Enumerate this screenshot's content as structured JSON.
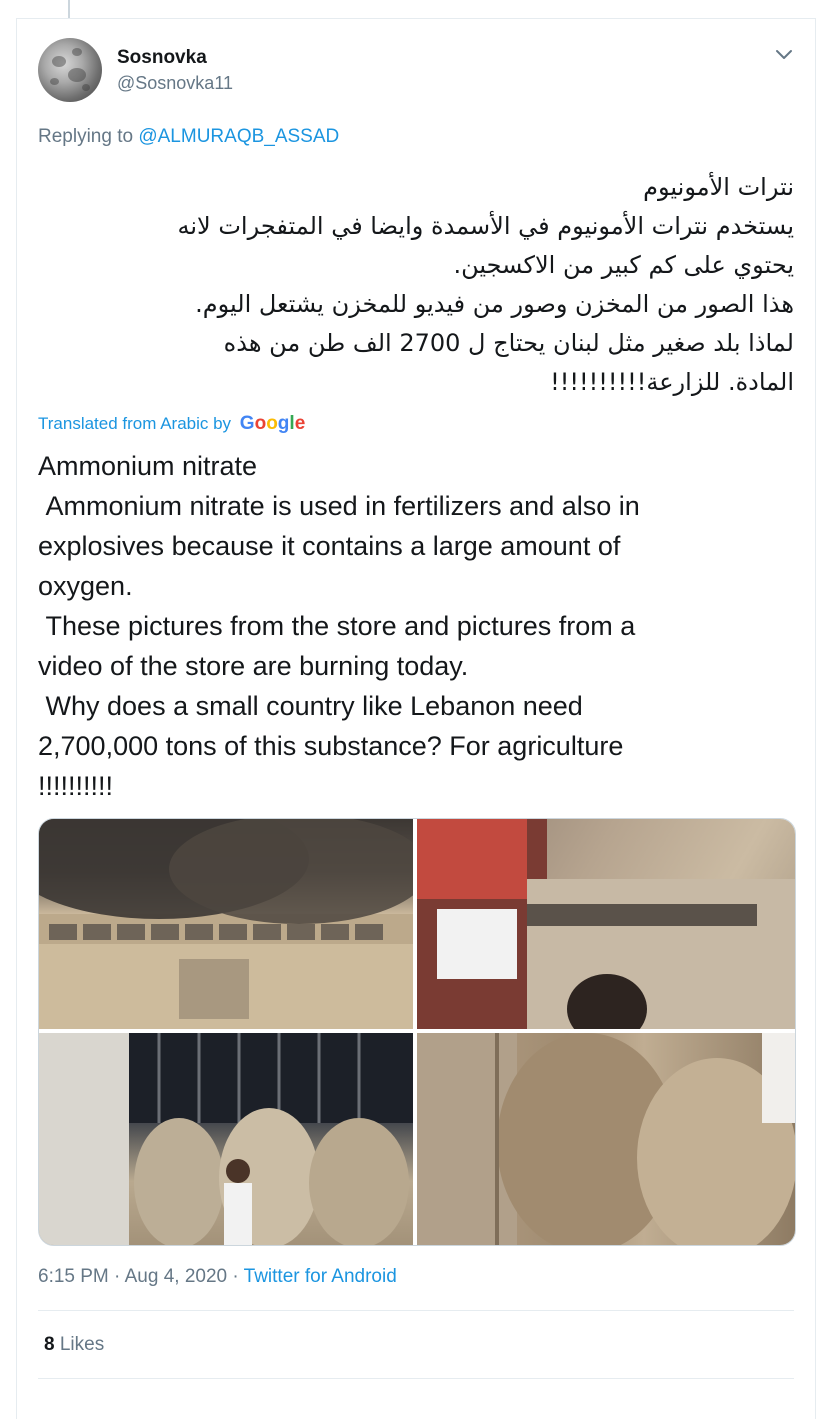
{
  "tweet": {
    "author_name": "Sosnovka",
    "author_handle": "@Sosnovka11",
    "replying_prefix": "Replying to",
    "replying_to": "@ALMURAQB_ASSAD",
    "arabic_lines": [
      "نترات الأمونيوم",
      "يستخدم نترات الأمونيوم في الأسمدة وايضا في المتفجرات لانه",
      "يحتوي على كم كبير من الاكسجين.",
      "هذا الصور من المخزن وصور من فيديو للمخزن يشتعل اليوم.",
      "لماذا بلد صغير مثل لبنان يحتاج ل 2700 الف طن من هذه",
      "المادة. للزارعة!!!!!!!!!!"
    ],
    "translated_label": "Translated from Arabic by",
    "translator_brand": "Google",
    "translation": "Ammonium nitrate\n Ammonium nitrate is used in fertilizers and also in\nexplosives because it contains a large amount of\noxygen.\n These pictures from the store and pictures from a\nvideo of the store are burning today.\n Why does a small country like Lebanon need\n2,700,000 tons of this substance? For agriculture\n!!!!!!!!!!",
    "time": "6:15 PM",
    "date": "Aug 4, 2020",
    "source": "Twitter for Android",
    "separator": "·",
    "likes_count": "8",
    "likes_label": "Likes"
  },
  "media": {
    "images": [
      {
        "name": "warehouse smoke"
      },
      {
        "name": "ammonium nitrate bag close-up"
      },
      {
        "name": "worker among sacks"
      },
      {
        "name": "stacked sacks"
      }
    ]
  },
  "icons": {
    "menu": "chevron-down-icon",
    "avatar": "moon-avatar"
  },
  "colors": {
    "link": "#1b95e0",
    "secondary": "#657786",
    "text": "#14171a"
  }
}
